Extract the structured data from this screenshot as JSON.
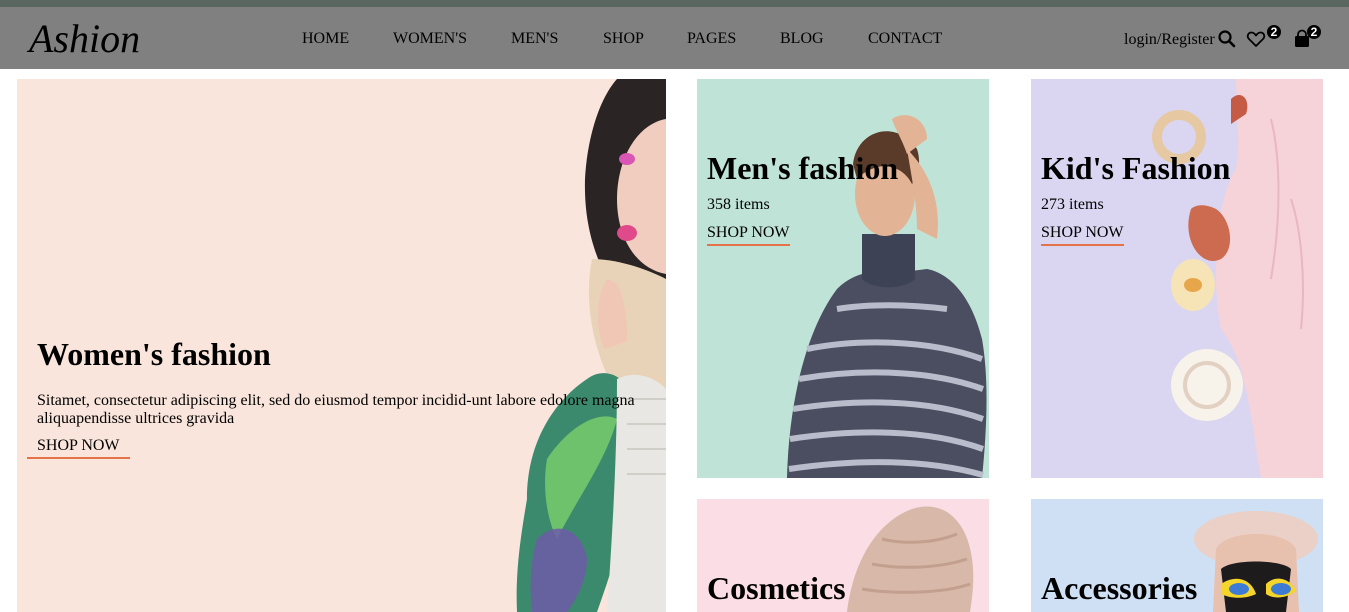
{
  "header": {
    "logo": "Ashion",
    "nav": [
      "HOME",
      "WOMEN'S",
      "MEN'S",
      "SHOP",
      "PAGES",
      "BLOG",
      "CONTACT"
    ],
    "login": "login/Register",
    "wishlist_count": "2",
    "cart_count": "2"
  },
  "hero": {
    "title": "Women's fashion",
    "text": "Sitamet, consectetur adipiscing elit, sed do eiusmod tempor incidid-unt labore edolore magna aliquapendisse ultrices gravida",
    "cta": "SHOP NOW"
  },
  "categories": [
    {
      "title": "Men's fashion",
      "count": "358 items",
      "cta": "SHOP NOW"
    },
    {
      "title": "Kid's Fashion",
      "count": "273 items",
      "cta": "SHOP NOW"
    },
    {
      "title": "Cosmetics"
    },
    {
      "title": "Accessories"
    }
  ],
  "colors": {
    "header_bg": "#808080",
    "women_bg": "#f9e5db",
    "men_bg": "#bfe3d6",
    "kids_bg": "#dad6f1",
    "cosmetics_bg": "#fbdde6",
    "accessories_bg": "#cfe0f4",
    "accent": "#e5734a"
  }
}
